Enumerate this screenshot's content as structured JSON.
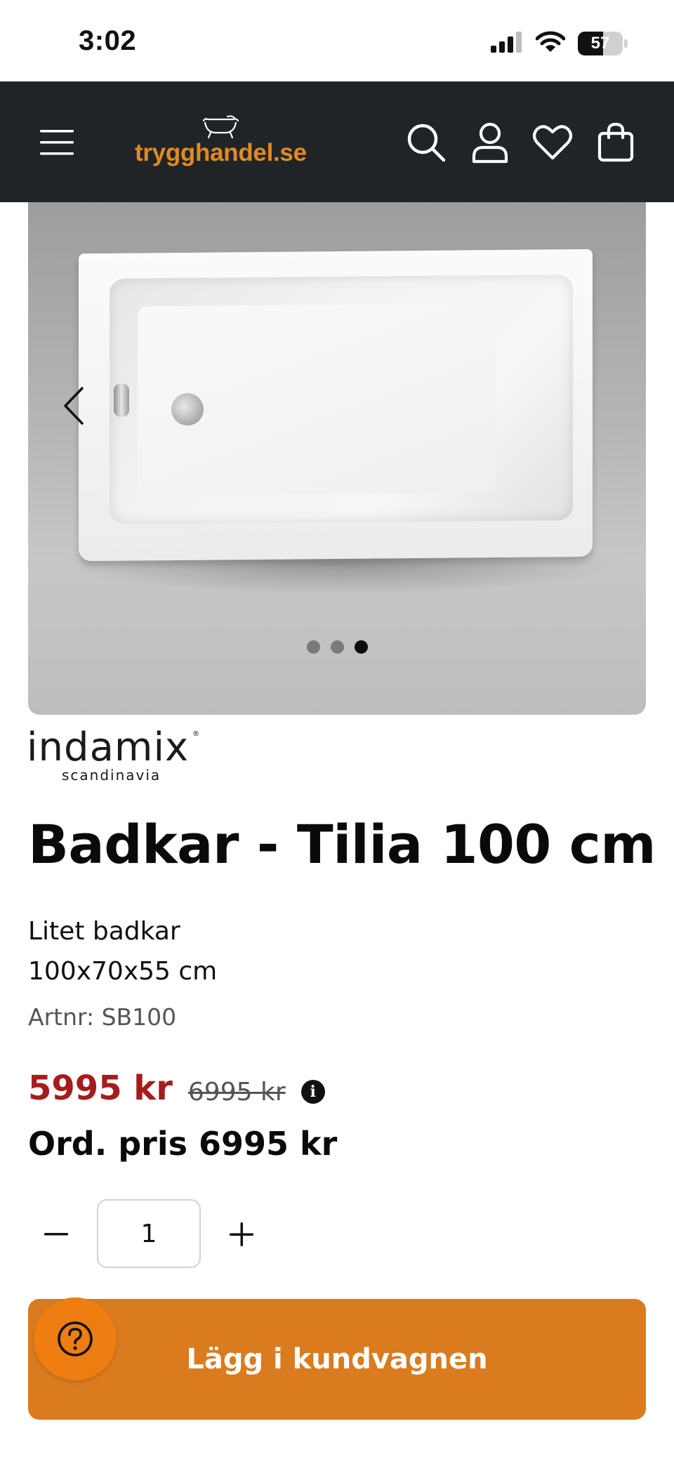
{
  "status_bar": {
    "time": "3:02",
    "battery": "57",
    "battery_level": 0.57
  },
  "header": {
    "logo_text": "trygghandel",
    "logo_tld": ".se",
    "icons": [
      "menu-icon",
      "search-icon",
      "account-icon",
      "heart-icon",
      "bag-icon"
    ],
    "colors": {
      "background": "#202427",
      "accent": "#e08a24"
    }
  },
  "carousel": {
    "slide_count": 3,
    "active_slide": 3
  },
  "brand": {
    "name": "indamix",
    "reg": "®",
    "sub": "scandinavia"
  },
  "product": {
    "title": "Badkar - Tilia 100 cm",
    "desc_line1": "Litet badkar",
    "desc_line2": "100x70x55 cm",
    "artnr": "Artnr: SB100",
    "price_sale": "5995 kr",
    "price_old": "6995 kr",
    "ord_price": "Ord. pris 6995 kr",
    "colors": {
      "sale": "#a61c1c"
    }
  },
  "quantity": {
    "value": "1"
  },
  "cart": {
    "add_label": "Lägg i kundvagnen",
    "colors": {
      "button": "#d97b1e",
      "help": "#ee7d12"
    }
  }
}
